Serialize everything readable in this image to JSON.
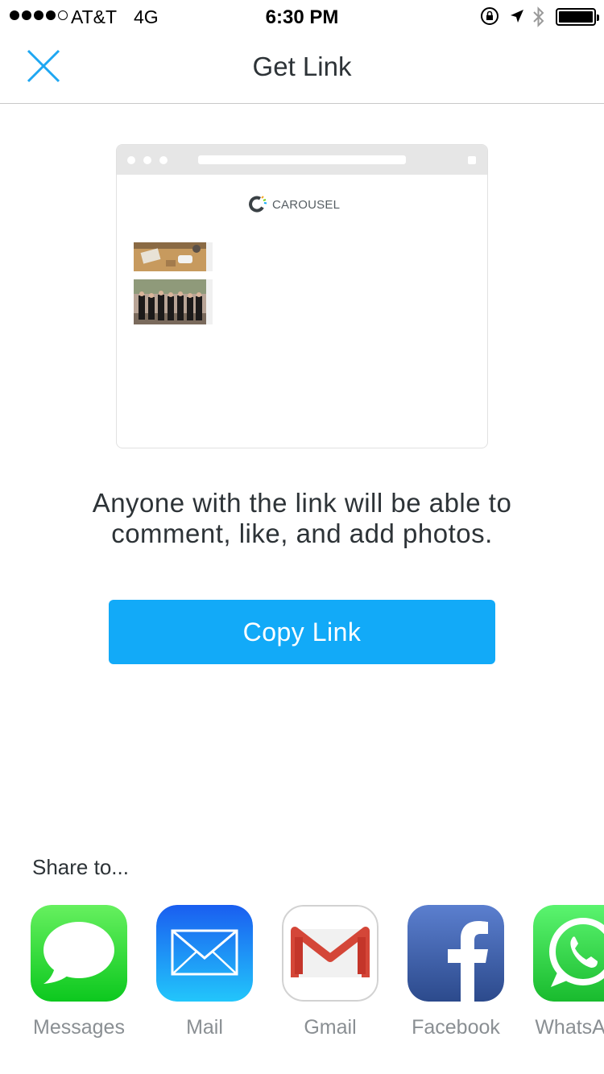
{
  "status_bar": {
    "carrier": "AT&T",
    "network": "4G",
    "time": "6:30 PM",
    "signal_bars_filled": 4,
    "signal_bars_total": 5,
    "battery_level": 1.0
  },
  "nav": {
    "title": "Get Link",
    "close_icon": "close-icon"
  },
  "preview": {
    "brand_name": "CAROUSEL"
  },
  "description": "Anyone with the link will be able to comment, like, and add photos.",
  "copy_link_label": "Copy Link",
  "share": {
    "heading": "Share to...",
    "apps": [
      {
        "label": "Messages",
        "icon": "messages-icon"
      },
      {
        "label": "Mail",
        "icon": "mail-icon"
      },
      {
        "label": "Gmail",
        "icon": "gmail-icon"
      },
      {
        "label": "Facebook",
        "icon": "facebook-icon"
      },
      {
        "label": "WhatsApp",
        "icon": "whatsapp-icon"
      }
    ]
  },
  "colors": {
    "accent": "#12aaf8",
    "close_icon": "#1ea7f2",
    "text": "#2d3337",
    "label_grey": "#8a8f93",
    "messages_green": "#4cd964",
    "mail_blue": "#1e8cf5",
    "gmail_red": "#d44638",
    "facebook_blue": "#3b5998",
    "whatsapp_green": "#25d366"
  }
}
